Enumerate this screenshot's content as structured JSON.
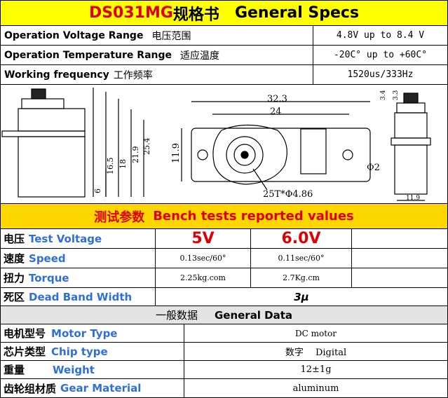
{
  "title": {
    "model": "DS031MG",
    "cn": "规格书",
    "en": "General Specs"
  },
  "specs": [
    {
      "label_en": "Operation Voltage Range",
      "label_cn": "电压范围",
      "value": "4.8V up to 8.4 V"
    },
    {
      "label_en": "Operation Temperature Range",
      "label_cn": "适应温度",
      "value": "-20C° up to +60C°"
    },
    {
      "label_en": "Working frequency",
      "label_cn": "工作频率",
      "value": "1520us/333Hz"
    }
  ],
  "drawing": {
    "dims": {
      "top_width": "32.3",
      "mid_width": "24",
      "height": "11.9",
      "side_25_4": "25.4",
      "side_21_9": "21.9",
      "side_18": "18",
      "side_16_5": "16.5",
      "side_6": "6",
      "spline": "25T*Φ4.86",
      "hole": "Φ2",
      "right_3_4": "3.4",
      "right_3_3": "3.3",
      "right_11_9": "11.9"
    }
  },
  "bench": {
    "header_cn": "测试参数",
    "header_en": "Bench tests reported values",
    "rows": [
      {
        "cn": "电压",
        "en": "Test Voltage",
        "v1": "5V",
        "v2": "6.0V",
        "v3": ""
      },
      {
        "cn": "速度",
        "en": "Speed",
        "v1": "0.13sec/60°",
        "v2": "0.11sec/60°",
        "v3": ""
      },
      {
        "cn": "扭力",
        "en": "Torque",
        "v1": "2.25kg.com",
        "v2": "2.7Kg.cm",
        "v3": ""
      },
      {
        "cn": "死区",
        "en": "Dead Band Width",
        "value": "3μ"
      }
    ]
  },
  "general": {
    "header_cn": "一般数据",
    "header_en": "General Data",
    "rows": [
      {
        "cn": "电机型号",
        "en": "Motor Type",
        "value": "DC motor"
      },
      {
        "cn": "芯片类型",
        "en": "Chip type",
        "value": "数字　 Digital"
      },
      {
        "cn": "重量",
        "en": "Weight",
        "value": "12±1g"
      },
      {
        "cn": "齿轮组材质",
        "en": "Gear Material",
        "value": "aluminum"
      }
    ]
  }
}
